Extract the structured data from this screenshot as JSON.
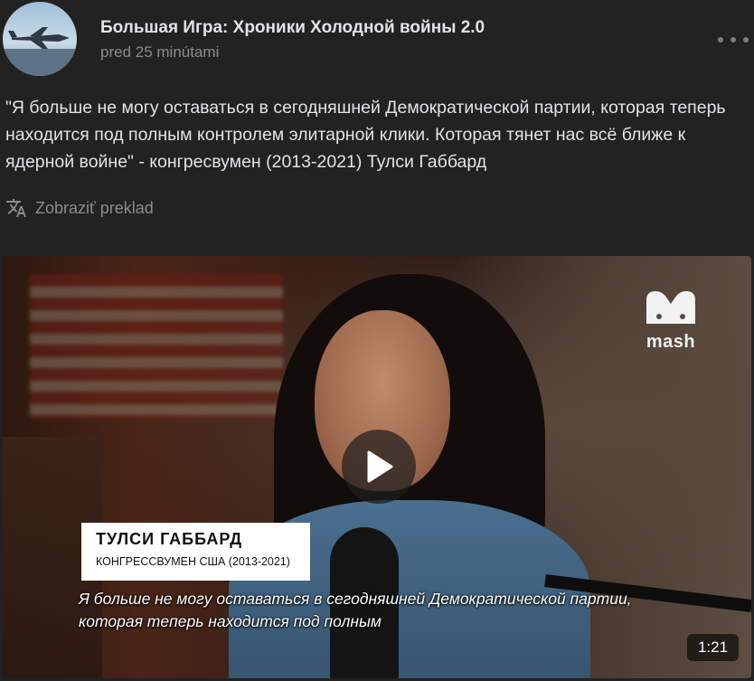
{
  "header": {
    "channel_name": "Большая Игра: Хроники Холодной войны 2.0",
    "timestamp": "pred 25 minútami",
    "more_icon": "more-horizontal-icon"
  },
  "post": {
    "text": "\"Я больше не могу оставаться в сегодняшней Демократической партии, которая теперь находится под полным контролем элитарной клики. Которая тянет нас всё ближе к ядерной войне\" - конгресвумен (2013-2021) Тулси Габбард",
    "translate_label": "Zobraziť preklad",
    "translate_icon": "translate-icon"
  },
  "video": {
    "logo_text": "mash",
    "name_card": {
      "name": "ТУЛСИ ГАББАРД",
      "title": "КОНГРЕССВУМЕН США (2013-2021)"
    },
    "subtitle": "Я больше не могу оставаться в сегодняшней Демократической партии, которая теперь находится под полным",
    "duration": "1:21",
    "play_icon": "play-icon"
  },
  "colors": {
    "background": "#222222",
    "text_primary": "#e1e3e6",
    "text_secondary": "#8a8c8f"
  }
}
